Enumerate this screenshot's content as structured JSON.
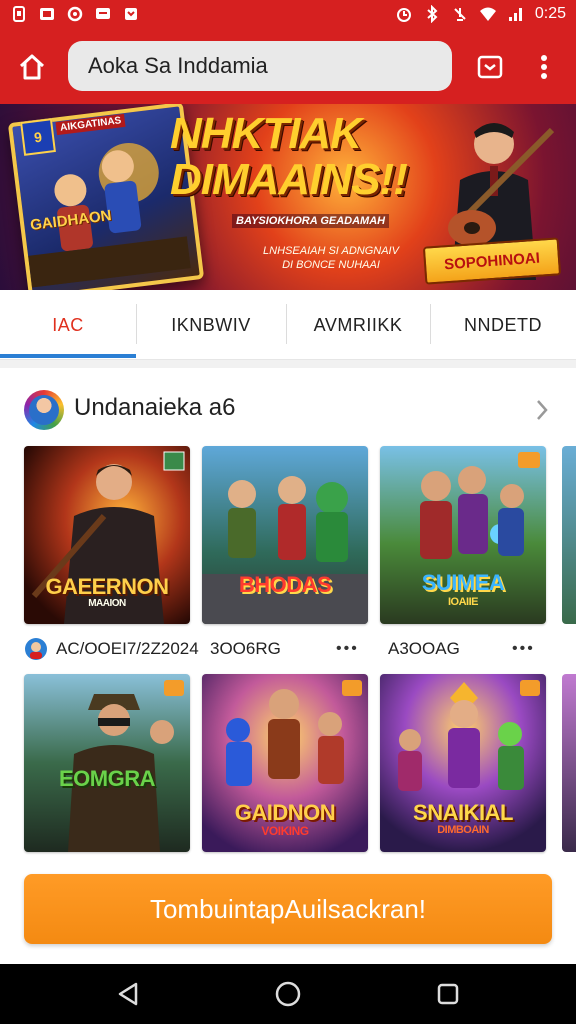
{
  "status_bar": {
    "time": "0:25",
    "left_icons": [
      "sim-icon",
      "photo-icon",
      "settings-icon",
      "message-icon",
      "notification-icon"
    ],
    "right_icons": [
      "alarm-icon",
      "bluetooth-icon",
      "mute-icon",
      "wifi-icon",
      "signal-icon"
    ]
  },
  "toolbar": {
    "url": "Aoka Sa Inddamia",
    "icons": [
      "home-icon",
      "tabs-icon",
      "overflow-menu-icon"
    ]
  },
  "banner": {
    "title_line1": "NHKTIAK",
    "title_line2": "DIMAAINS!!",
    "subtitle": "BAYSIOKHORA GEADAMAH",
    "tagline_line1": "LNHSEAIAH SI ADNGNAIV",
    "tagline_line2": "DI BONCE NUHAAI",
    "card_title": "GAIDHAON",
    "card_badge": "9",
    "card_tag": "AIKGATINAS",
    "cta_label": "SOPOHINOAI"
  },
  "tabs": [
    {
      "label": "IAC",
      "active": true
    },
    {
      "label": "IKNBWIV",
      "active": false
    },
    {
      "label": "AVMRIIKK",
      "active": false
    },
    {
      "label": "NNDETD",
      "active": false
    }
  ],
  "section": {
    "title": "Undanaieka a6"
  },
  "games_row1": [
    {
      "title": "GAEERNON",
      "subtitle": "MAAION",
      "meta": "AC/OOEI7/2Z2024"
    },
    {
      "title": "BHODAS",
      "subtitle": "",
      "meta": "3OO6RG"
    },
    {
      "title": "SUIMEA",
      "subtitle": "IOAIIE",
      "meta": "A3OOAG"
    }
  ],
  "games_row2": [
    {
      "title": "EOMGRA",
      "subtitle": ""
    },
    {
      "title": "GAIDNON",
      "subtitle": "VOIKING"
    },
    {
      "title": "SNAIKIAL",
      "subtitle": "DIMBOAIN"
    }
  ],
  "more_dots": "•••",
  "cta": {
    "label": "TombuintapАuilsackran!"
  },
  "nav": {
    "icons": [
      "back-icon",
      "home-circle-icon",
      "recents-icon"
    ]
  },
  "colors": {
    "brand_red": "#d62020",
    "accent_orange": "#f48a12",
    "tab_active": "#e0301e",
    "tab_indicator": "#2b7fd4"
  }
}
